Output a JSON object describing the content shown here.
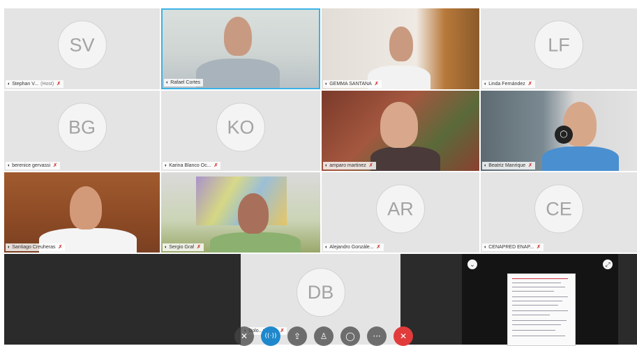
{
  "participants": [
    {
      "initials": "SV",
      "name": "Stephan V...",
      "host_tag": "(Host)",
      "muted": "🎙"
    },
    {
      "initials": "",
      "name": "Rafael Cortes",
      "muted": ""
    },
    {
      "initials": "",
      "name": "GEMMA SANTANA",
      "muted": "🎙"
    },
    {
      "initials": "LF",
      "name": "Linda Fernández",
      "muted": "🎙"
    },
    {
      "initials": "BG",
      "name": "berenice gervassi",
      "muted": "🎙"
    },
    {
      "initials": "KO",
      "name": "Karina Blanco Oc...",
      "muted": "🎙"
    },
    {
      "initials": "",
      "name": "amparo martinez",
      "muted": "🎙"
    },
    {
      "initials": "",
      "name": "Beatriz Manrique",
      "muted": "🎙"
    },
    {
      "initials": "",
      "name": "Santiago Creuheras",
      "muted": "🎙"
    },
    {
      "initials": "",
      "name": "Sergio Graf",
      "muted": "🎙"
    },
    {
      "initials": "AR",
      "name": "Alejandro Gonzále...",
      "muted": "🎙"
    },
    {
      "initials": "CE",
      "name": "CENAPRED ENAP...",
      "muted": "🎙"
    },
    {
      "initials": "DB",
      "name": "Dolo...rientos",
      "muted": "🎙"
    }
  ],
  "icons": {
    "mic": "◖",
    "muted": "✗",
    "chat_bubble": "◯",
    "share_collapse": "⌄",
    "share_expand": "⤢"
  },
  "toolbar": {
    "mic_icon": "✕",
    "audio_icon": "((·))",
    "share_icon": "⇪",
    "participants_icon": "♙",
    "chat_icon": "◯",
    "more_icon": "···",
    "hangup_icon": "✕"
  },
  "colors": {
    "active_speaker": "#3ab3e6",
    "hangup": "#e23b3b",
    "audio_active": "#1f88cc",
    "muted": "#d23c3c"
  }
}
